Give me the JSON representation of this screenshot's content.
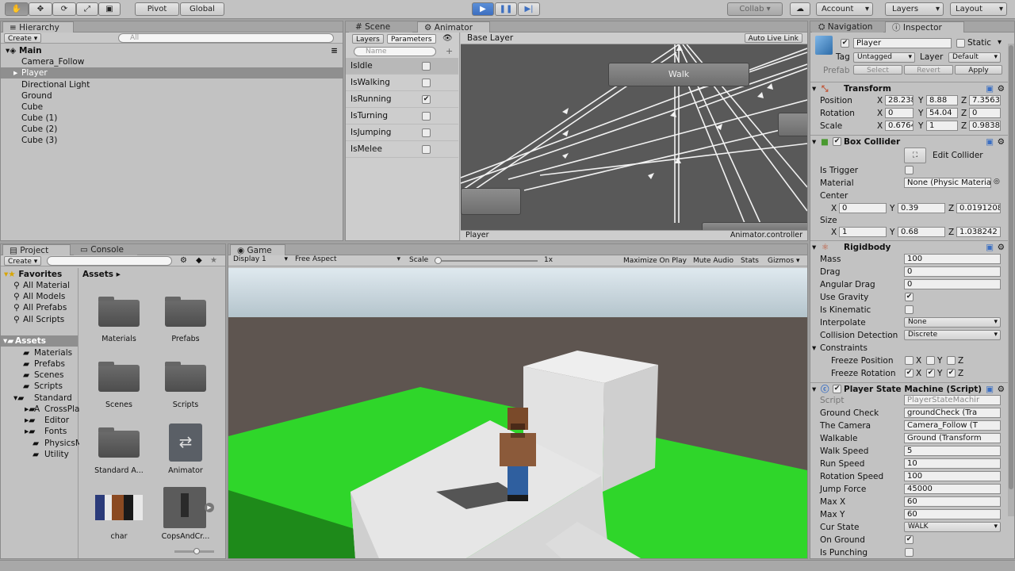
{
  "toolbar": {
    "tools": [
      "hand-icon",
      "move-icon",
      "rotate-icon",
      "scale-icon",
      "rect-icon"
    ],
    "pivot_label": "Pivot",
    "global_label": "Global",
    "collab_label": "Collab ▾",
    "account_label": "Account",
    "layers_label": "Layers",
    "layout_label": "Layout"
  },
  "hierarchy": {
    "tab": "Hierarchy",
    "create_label": "Create ▾",
    "search_placeholder": "All",
    "scene": "Main",
    "items": [
      "Camera_Follow",
      "Player",
      "Directional Light",
      "Ground",
      "Cube",
      "Cube (1)",
      "Cube (2)",
      "Cube (3)"
    ]
  },
  "animator": {
    "tab_scene": "Scene",
    "tab_animator": "Animator",
    "layers_tab": "Layers",
    "parameters_tab": "Parameters",
    "search_placeholder": "Name",
    "params": [
      {
        "name": "IsIdle",
        "checked": false
      },
      {
        "name": "IsWalking",
        "checked": false
      },
      {
        "name": "IsRunning",
        "checked": true
      },
      {
        "name": "IsTurning",
        "checked": false
      },
      {
        "name": "IsJumping",
        "checked": false
      },
      {
        "name": "IsMelee",
        "checked": false
      }
    ],
    "breadcrumb": "Base Layer",
    "auto_live_link": "Auto Live Link",
    "state_walk": "Walk",
    "footer_left": "Player",
    "footer_right": "Animator.controller"
  },
  "inspector": {
    "tab_navigation": "Navigation",
    "tab_inspector": "Inspector",
    "object_name": "Player",
    "static_label": "Static",
    "tag_label": "Tag",
    "tag_value": "Untagged",
    "layer_label": "Layer",
    "layer_value": "Default",
    "prefab_label": "Prefab",
    "select_label": "Select",
    "revert_label": "Revert",
    "apply_label": "Apply",
    "transform": {
      "title": "Transform",
      "position_label": "Position",
      "pos": [
        "28.238",
        "8.88",
        "7.3563"
      ],
      "rotation_label": "Rotation",
      "rot": [
        "0",
        "54.04",
        "0"
      ],
      "scale_label": "Scale",
      "scale": [
        "0.6764",
        "1",
        "0.9838"
      ]
    },
    "box_collider": {
      "title": "Box Collider",
      "edit_label": "Edit Collider",
      "is_trigger_label": "Is Trigger",
      "material_label": "Material",
      "material_value": "None (Physic Materia",
      "center_label": "Center",
      "center": [
        "0",
        "0.39",
        "0.0191208"
      ],
      "size_label": "Size",
      "size": [
        "1",
        "0.68",
        "1.038242"
      ]
    },
    "rigidbody": {
      "title": "Rigidbody",
      "mass_label": "Mass",
      "mass": "100",
      "drag_label": "Drag",
      "drag": "0",
      "angular_drag_label": "Angular Drag",
      "angular_drag": "0",
      "use_gravity_label": "Use Gravity",
      "is_kinematic_label": "Is Kinematic",
      "interpolate_label": "Interpolate",
      "interpolate": "None",
      "collision_label": "Collision Detection",
      "collision": "Discrete",
      "constraints_label": "Constraints",
      "freeze_pos_label": "Freeze Position",
      "freeze_rot_label": "Freeze Rotation"
    },
    "script": {
      "title": "Player State Machine (Script)",
      "script_label": "Script",
      "script_value": "PlayerStateMachir",
      "ground_check_label": "Ground Check",
      "ground_check": "groundCheck (Tra",
      "camera_label": "The Camera",
      "camera": "Camera_Follow (T",
      "walkable_label": "Walkable",
      "walkable": "Ground (Transform",
      "walk_speed_label": "Walk Speed",
      "walk_speed": "5",
      "run_speed_label": "Run Speed",
      "run_speed": "10",
      "rotation_speed_label": "Rotation Speed",
      "rotation_speed": "100",
      "jump_force_label": "Jump Force",
      "jump_force": "45000",
      "max_x_label": "Max X",
      "max_x": "60",
      "max_y_label": "Max Y",
      "max_y": "60",
      "cur_state_label": "Cur State",
      "cur_state": "WALK",
      "on_ground_label": "On Ground",
      "is_punching_label": "Is Punching"
    }
  },
  "project": {
    "tab_project": "Project",
    "tab_console": "Console",
    "create_label": "Create ▾",
    "favorites_label": "Favorites",
    "favorites": [
      "All Material",
      "All Models",
      "All Prefabs",
      "All Scripts"
    ],
    "assets_label": "Assets",
    "tree": [
      "Materials",
      "Prefabs",
      "Scenes",
      "Scripts",
      "Standard A",
      "CrossPla",
      "Editor",
      "Fonts",
      "PhysicsM",
      "Utility"
    ],
    "breadcrumb": "Assets ▸",
    "grid": [
      "Materials",
      "Prefabs",
      "Scenes",
      "Scripts",
      "Standard A...",
      "Animator",
      "char",
      "CopsAndCr..."
    ]
  },
  "game": {
    "tab": "Game",
    "display": "Display 1",
    "aspect": "Free Aspect",
    "scale_label": "Scale",
    "scale_value": "1x",
    "maximize": "Maximize On Play",
    "mute": "Mute Audio",
    "stats": "Stats",
    "gizmos": "Gizmos ▾"
  },
  "colors": {
    "accent": "#3d6fc0",
    "ground": "#2fd62a",
    "sky": "#c9dbe8"
  }
}
